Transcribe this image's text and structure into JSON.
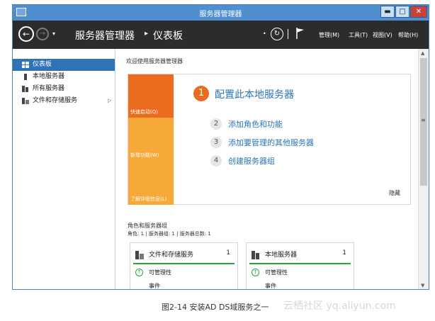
{
  "window": {
    "title": "服务器管理器",
    "buttons": {
      "minimize": "▬",
      "maximize": "□",
      "close": "✕"
    }
  },
  "toolbar": {
    "breadcrumb": [
      "服务器管理器",
      "仪表板"
    ],
    "separator": "▸",
    "dropdown": "▾",
    "refresh_dropdown": "•",
    "divider": "|",
    "menus": [
      "管理(M)",
      "工具(T)",
      "视图(V)",
      "帮助(H)"
    ]
  },
  "sidebar": {
    "items": [
      {
        "label": "仪表板",
        "icon": "dashboard-icon",
        "active": true
      },
      {
        "label": "本地服务器",
        "icon": "server-icon",
        "active": false
      },
      {
        "label": "所有服务器",
        "icon": "servers-icon",
        "active": false
      },
      {
        "label": "文件和存储服务",
        "icon": "storage-icon",
        "active": false,
        "expand": "▷"
      }
    ]
  },
  "main": {
    "welcome_title": "欢迎使用服务器管理器",
    "tiles": [
      "快速启动(Q)",
      "新增功能(W)",
      "了解详细信息(L)"
    ],
    "steps": [
      {
        "num": "1",
        "label": "配置此本地服务器"
      },
      {
        "num": "2",
        "label": "添加角色和功能"
      },
      {
        "num": "3",
        "label": "添加要管理的其他服务器"
      },
      {
        "num": "4",
        "label": "创建服务器组"
      }
    ],
    "hide_label": "隐藏",
    "roles_title": "角色和服务器组",
    "roles_summary": "角色: 1 | 服务器组: 1 | 服务器总数: 1",
    "cards": [
      {
        "title": "文件和存储服务",
        "count": "1",
        "status": "可管理性",
        "events": "事件"
      },
      {
        "title": "本地服务器",
        "count": "1",
        "status": "可管理性",
        "events": "事件"
      }
    ]
  },
  "scrollbar": {
    "up": "▲",
    "down": "▼",
    "grip": "≡"
  },
  "caption": "图2-14 安装AD DS域服务之一",
  "watermark": "云栖社区 yq.aliyun.com",
  "colors": {
    "titlebar": "#4f8fd0",
    "toolbar": "#2c2c2c",
    "accent_orange": "#ec6c1f",
    "tile_light": "#f6a938",
    "link_blue": "#2a74b8",
    "selection_blue": "#2f73b7",
    "ok_green": "#27a836"
  }
}
